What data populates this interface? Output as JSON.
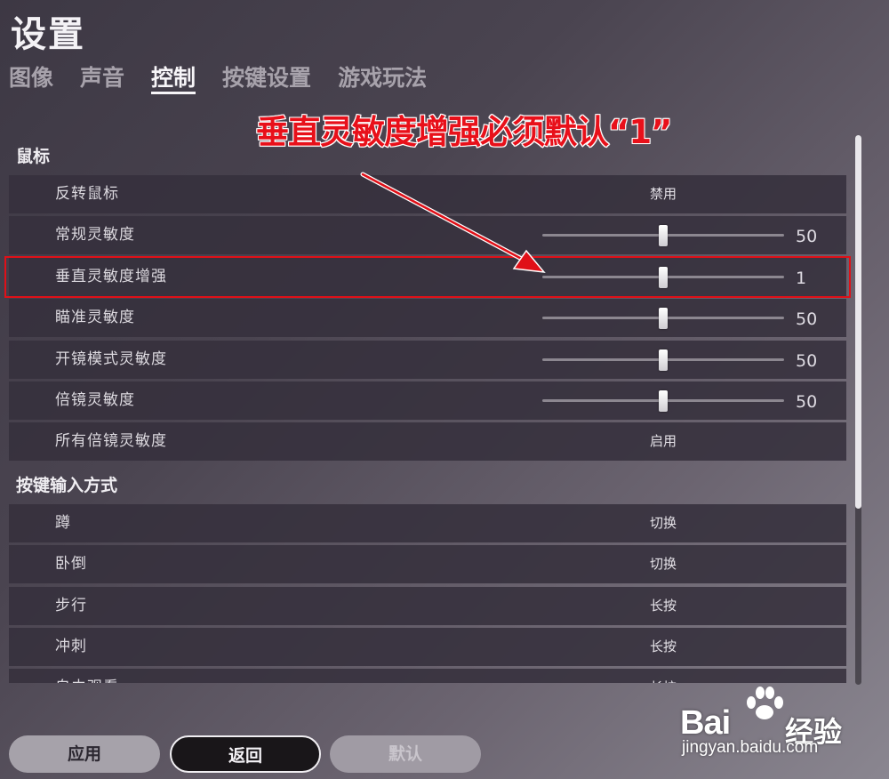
{
  "title": "设置",
  "tabs": [
    {
      "label": "图像",
      "active": false
    },
    {
      "label": "声音",
      "active": false
    },
    {
      "label": "控制",
      "active": true
    },
    {
      "label": "按键设置",
      "active": false
    },
    {
      "label": "游戏玩法",
      "active": false
    }
  ],
  "annotation": {
    "text": "垂直灵敏度增强必须默认“1”",
    "color": "#e8101a"
  },
  "sections": {
    "mouse": {
      "header": "鼠标",
      "rows": [
        {
          "label": "反转鼠标",
          "value": "禁用"
        },
        {
          "label": "常规灵敏度",
          "slider_value": "50",
          "fraction": 0.5
        },
        {
          "label": "垂直灵敏度增强",
          "slider_value": "1",
          "fraction": 0.5
        },
        {
          "label": "瞄准灵敏度",
          "slider_value": "50",
          "fraction": 0.5
        },
        {
          "label": "开镜模式灵敏度",
          "slider_value": "50",
          "fraction": 0.5
        },
        {
          "label": "倍镜灵敏度",
          "slider_value": "50",
          "fraction": 0.5
        },
        {
          "label": "所有倍镜灵敏度",
          "value": "启用"
        }
      ]
    },
    "input": {
      "header": "按键输入方式",
      "rows": [
        {
          "label": "蹲",
          "value": "切换"
        },
        {
          "label": "卧倒",
          "value": "切换"
        },
        {
          "label": "步行",
          "value": "长按"
        },
        {
          "label": "冲刺",
          "value": "长按"
        },
        {
          "label": "自由观看",
          "value": "长按"
        }
      ]
    }
  },
  "buttons": {
    "apply": "应用",
    "back": "返回",
    "default": "默认"
  },
  "watermark": {
    "brand": "Bai",
    "brand_cn": "经验",
    "url": "jingyan.baidu.com"
  }
}
